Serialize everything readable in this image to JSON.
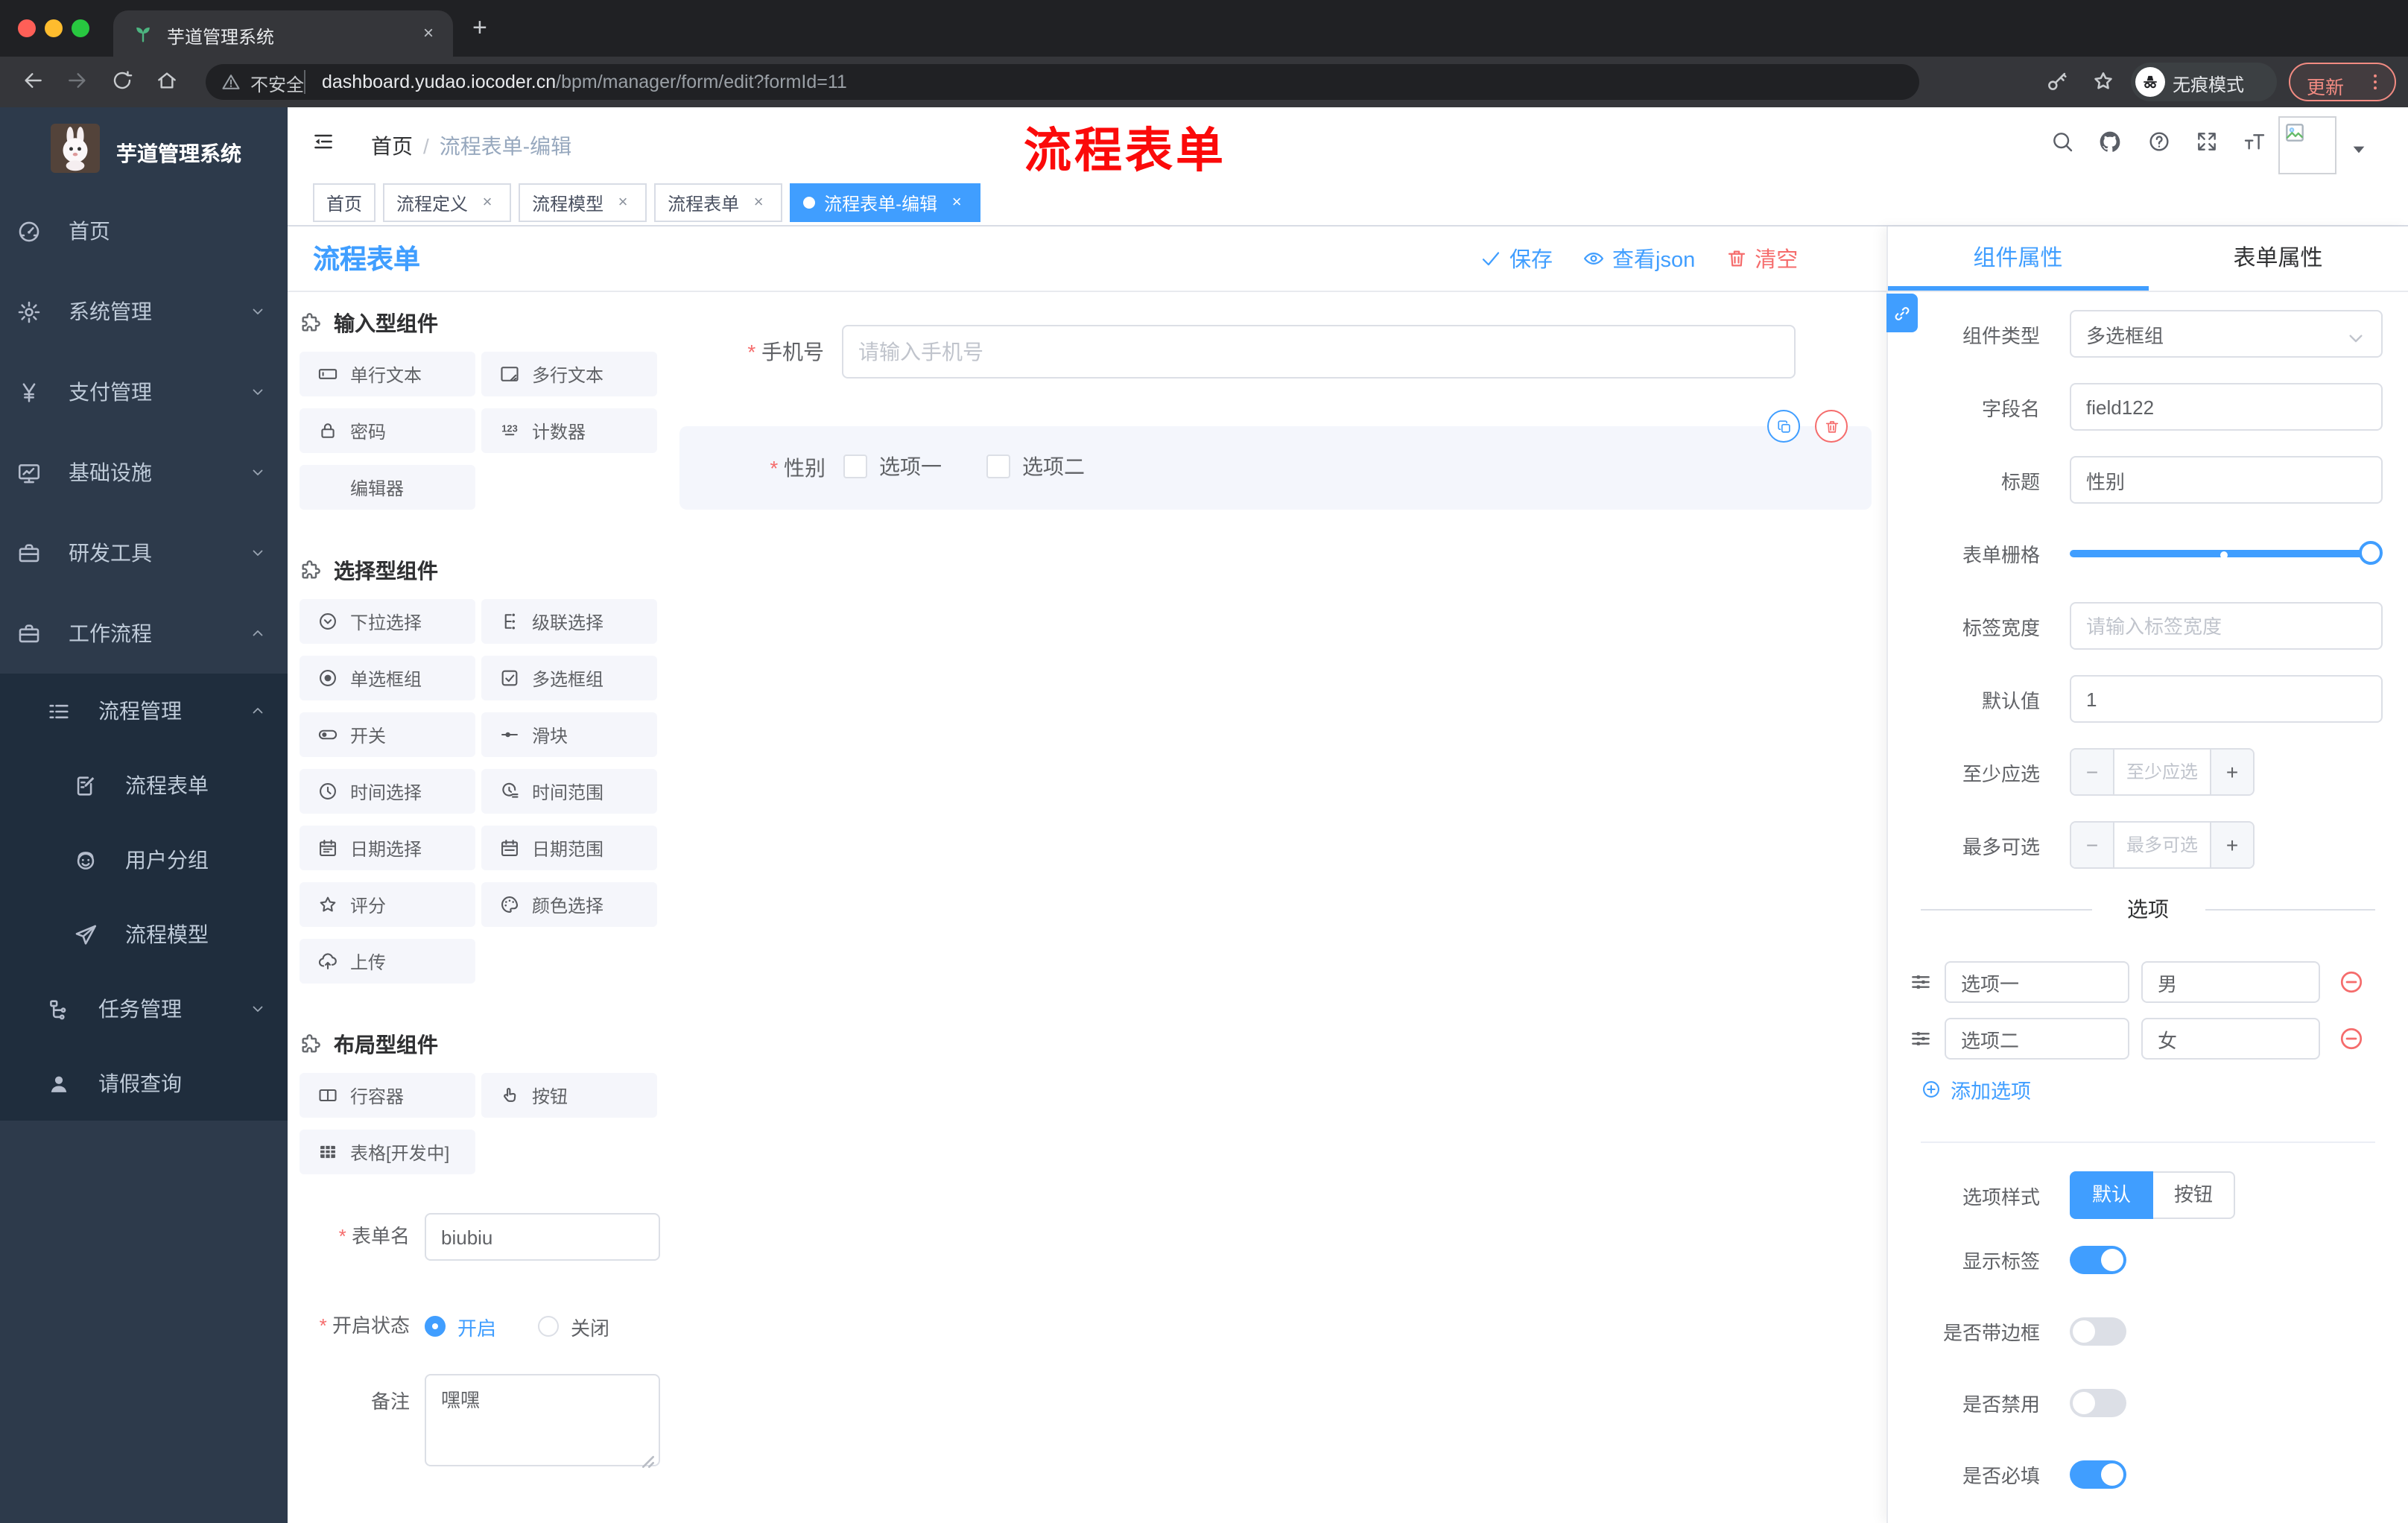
{
  "browser": {
    "tab_title": "芋道管理系统",
    "security_label": "不安全",
    "url_domain": "dashboard.yudao.iocoder.cn",
    "url_path": "/bpm/manager/form/edit?formId=11",
    "incognito_label": "无痕模式",
    "update_label": "更新"
  },
  "sidebar": {
    "brand": "芋道管理系统",
    "items": [
      {
        "label": "首页",
        "icon": "dashboard",
        "level": 1
      },
      {
        "label": "系统管理",
        "icon": "gear",
        "level": 1,
        "chevron": "down"
      },
      {
        "label": "支付管理",
        "icon": "yen",
        "level": 1,
        "chevron": "down"
      },
      {
        "label": "基础设施",
        "icon": "monitor",
        "level": 1,
        "chevron": "down"
      },
      {
        "label": "研发工具",
        "icon": "briefcase",
        "level": 1,
        "chevron": "down"
      },
      {
        "label": "工作流程",
        "icon": "briefcase",
        "level": 1,
        "chevron": "up"
      },
      {
        "label": "流程管理",
        "icon": "list",
        "level": 2,
        "chevron": "up",
        "dark": true
      },
      {
        "label": "流程表单",
        "icon": "form",
        "level": 3,
        "dark": true
      },
      {
        "label": "用户分组",
        "icon": "users",
        "level": 3,
        "dark": true
      },
      {
        "label": "流程模型",
        "icon": "send",
        "level": 3,
        "dark": true
      },
      {
        "label": "任务管理",
        "icon": "tree",
        "level": 2,
        "chevron": "down",
        "dark": true
      },
      {
        "label": "请假查询",
        "icon": "user",
        "level": 2,
        "dark": true
      }
    ]
  },
  "navbar": {
    "breadcrumb_home": "首页",
    "breadcrumb_current": "流程表单-编辑",
    "annotation": "流程表单"
  },
  "tags": [
    {
      "label": "首页",
      "closable": false,
      "active": false
    },
    {
      "label": "流程定义",
      "closable": true,
      "active": false
    },
    {
      "label": "流程模型",
      "closable": true,
      "active": false
    },
    {
      "label": "流程表单",
      "closable": true,
      "active": false
    },
    {
      "label": "流程表单-编辑",
      "closable": true,
      "active": true
    }
  ],
  "designer": {
    "title": "流程表单",
    "save": "保存",
    "view_json": "查看json",
    "clear": "清空"
  },
  "components": {
    "sections": [
      {
        "title": "输入型组件",
        "items": [
          {
            "label": "单行文本",
            "icon": "input"
          },
          {
            "label": "多行文本",
            "icon": "textarea"
          },
          {
            "label": "密码",
            "icon": "lock"
          },
          {
            "label": "计数器",
            "icon": "counter"
          },
          {
            "label": "编辑器",
            "icon": "none"
          }
        ]
      },
      {
        "title": "选择型组件",
        "items": [
          {
            "label": "下拉选择",
            "icon": "select"
          },
          {
            "label": "级联选择",
            "icon": "cascader"
          },
          {
            "label": "单选框组",
            "icon": "radio"
          },
          {
            "label": "多选框组",
            "icon": "checkbox"
          },
          {
            "label": "开关",
            "icon": "switch"
          },
          {
            "label": "滑块",
            "icon": "slider"
          },
          {
            "label": "时间选择",
            "icon": "time"
          },
          {
            "label": "时间范围",
            "icon": "timerange"
          },
          {
            "label": "日期选择",
            "icon": "date"
          },
          {
            "label": "日期范围",
            "icon": "daterange"
          },
          {
            "label": "评分",
            "icon": "star"
          },
          {
            "label": "颜色选择",
            "icon": "palette"
          },
          {
            "label": "上传",
            "icon": "upload"
          }
        ]
      },
      {
        "title": "布局型组件",
        "items": [
          {
            "label": "行容器",
            "icon": "row"
          },
          {
            "label": "按钮",
            "icon": "button"
          },
          {
            "label": "表格[开发中]",
            "icon": "table"
          }
        ]
      }
    ],
    "form": {
      "name_label": "表单名",
      "name_value": "biubiu",
      "status_label": "开启状态",
      "status_on": "开启",
      "status_off": "关闭",
      "status_selected": "开启",
      "remark_label": "备注",
      "remark_value": "嘿嘿"
    }
  },
  "canvas": {
    "phone": {
      "label": "手机号",
      "placeholder": "请输入手机号",
      "required": true
    },
    "gender": {
      "label": "性别",
      "required": true,
      "options": [
        "选项一",
        "选项二"
      ]
    }
  },
  "props": {
    "tabs": [
      "组件属性",
      "表单属性"
    ],
    "active_tab": "组件属性",
    "type_label": "组件类型",
    "type_value": "多选框组",
    "field_label": "字段名",
    "field_value": "field122",
    "title_label": "标题",
    "title_value": "性别",
    "grid_label": "表单栅格",
    "label_width_label": "标签宽度",
    "label_width_placeholder": "请输入标签宽度",
    "default_label": "默认值",
    "default_value": "1",
    "min_label": "至少应选",
    "min_placeholder": "至少应选",
    "max_label": "最多可选",
    "max_placeholder": "最多可选",
    "options_divider": "选项",
    "options": [
      {
        "label": "选项一",
        "value": "男"
      },
      {
        "label": "选项二",
        "value": "女"
      }
    ],
    "add_option": "添加选项",
    "style_label": "选项样式",
    "style_choices": [
      "默认",
      "按钮"
    ],
    "style_active": "默认",
    "toggles": [
      {
        "label": "显示标签",
        "on": true
      },
      {
        "label": "是否带边框",
        "on": false
      },
      {
        "label": "是否禁用",
        "on": false
      },
      {
        "label": "是否必填",
        "on": true
      }
    ]
  },
  "colors": {
    "accent": "#409eff",
    "danger": "#f56c6c",
    "annotation": "#fb0a0a",
    "sidebar_bg": "#2d3a4b",
    "submenu_bg": "#1f2d3d"
  }
}
